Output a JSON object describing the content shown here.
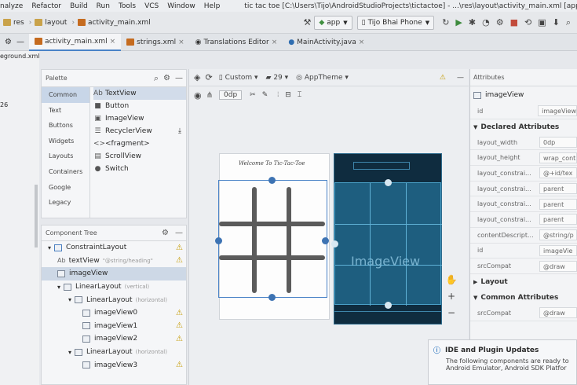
{
  "menubar": {
    "items": [
      "nalyze",
      "Refactor",
      "Build",
      "Run",
      "Tools",
      "VCS",
      "Window",
      "Help"
    ],
    "title": "tic tac toe [C:\\Users\\Tijo\\AndroidStudioProjects\\tictactoe] - ...\\res\\layout\\activity_main.xml [app]"
  },
  "navbar": {
    "crumbs": [
      "res",
      "layout",
      "activity_main.xml"
    ],
    "run_config": "app",
    "device": "Tijo Bhai Phone"
  },
  "tabs": [
    {
      "label": "activity_main.xml"
    },
    {
      "label": "strings.xml"
    },
    {
      "label": "Translations Editor"
    },
    {
      "label": "MainActivity.java"
    }
  ],
  "leftstrip": {
    "file": "eground.xml",
    "number": "26"
  },
  "palette": {
    "title": "Palette",
    "categories": [
      "Common",
      "Text",
      "Buttons",
      "Widgets",
      "Layouts",
      "Containers",
      "Google",
      "Legacy"
    ],
    "items": [
      {
        "label": "TextView",
        "icon": "Ab"
      },
      {
        "label": "Button",
        "icon": "■"
      },
      {
        "label": "ImageView",
        "icon": "▣"
      },
      {
        "label": "RecyclerView",
        "icon": "☰"
      },
      {
        "label": "<fragment>",
        "icon": "<>"
      },
      {
        "label": "ScrollView",
        "icon": "▤"
      },
      {
        "label": "Switch",
        "icon": "●"
      }
    ]
  },
  "component_tree": {
    "title": "Component Tree",
    "rows": [
      {
        "label": "ConstraintLayout",
        "hint": ""
      },
      {
        "label": "textView",
        "hint": "\"@string/heading\""
      },
      {
        "label": "imageView",
        "hint": ""
      },
      {
        "label": "LinearLayout",
        "hint": "(vertical)"
      },
      {
        "label": "LinearLayout",
        "hint": "(horizontal)"
      },
      {
        "label": "imageView0",
        "hint": ""
      },
      {
        "label": "imageView1",
        "hint": ""
      },
      {
        "label": "imageView2",
        "hint": ""
      },
      {
        "label": "LinearLayout",
        "hint": "(horizontal)"
      },
      {
        "label": "imageView3",
        "hint": ""
      }
    ]
  },
  "design_toolbar": {
    "device": "Custom",
    "api": "29",
    "theme": "AppTheme",
    "margin": "0dp"
  },
  "blueprint": {
    "welcome_text": "Welcome To Tic-Tac-Toe",
    "image_label": "ImageView"
  },
  "attributes": {
    "title": "Attributes",
    "component": "imageView",
    "id_key": "id",
    "id_value": "imageView",
    "declared_title": "Declared Attributes",
    "declared": [
      {
        "k": "layout_width",
        "v": "0dp"
      },
      {
        "k": "layout_height",
        "v": "wrap_cont"
      },
      {
        "k": "layout_constrai...",
        "v": "@+id/tex"
      },
      {
        "k": "layout_constrai...",
        "v": "parent"
      },
      {
        "k": "layout_constrai...",
        "v": "parent"
      },
      {
        "k": "layout_constrai...",
        "v": "parent"
      },
      {
        "k": "contentDescript...",
        "v": "@string/p"
      },
      {
        "k": "id",
        "v": "imageVie"
      },
      {
        "k": "srcCompat",
        "v": "@draw"
      }
    ],
    "layout_title": "Layout",
    "common_title": "Common Attributes",
    "common": [
      {
        "k": "srcCompat",
        "v": "@draw"
      }
    ]
  },
  "notification": {
    "title": "IDE and Plugin Updates",
    "line1": "The following components are ready to",
    "line2": "Android Emulator, Android SDK Platfor"
  },
  "colors": {
    "accent": "#4a83c7",
    "blueprint": "#1e5e7f",
    "grid_lines": "#5a5a5a"
  }
}
